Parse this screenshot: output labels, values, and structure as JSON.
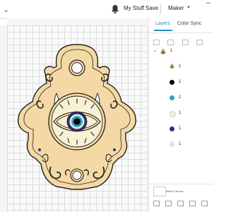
{
  "header": {
    "back_icon": "chevron-down-icon",
    "notification_icon": "bell-icon",
    "my_stuff": "My Stuff",
    "save": "Save",
    "machine": "Maker"
  },
  "panel": {
    "tabs": [
      {
        "label": "Layers"
      },
      {
        "label": "Color Sync"
      }
    ],
    "group": {
      "label": "1"
    },
    "layers": [
      {
        "label": "1",
        "color": "#c9a774",
        "icon": "hamsa-icon"
      },
      {
        "label": "1",
        "color": "#000000"
      },
      {
        "label": "1",
        "color": "#2aa3c9"
      },
      {
        "label": "1",
        "color": "#f7f1d6"
      },
      {
        "label": "1",
        "color": "#2d2f7a"
      },
      {
        "label": "1",
        "color": "#cccccc",
        "icon": "hamsa-outline-icon"
      }
    ],
    "canvas_label": "Blank Canvas"
  },
  "design": {
    "wood_color": "#f4d9a6",
    "outline_color": "#1f1f1f",
    "eye_outer": "#f7f1d6",
    "iris_outer": "#2d2f7a",
    "iris_mid": "#2aa3c9",
    "pupil": "#000000"
  }
}
